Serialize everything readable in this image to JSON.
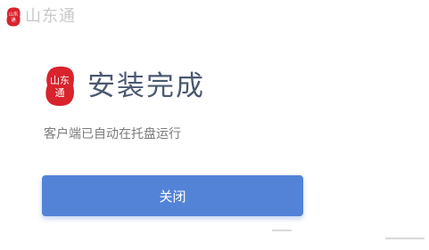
{
  "window": {
    "app_title": "山东通"
  },
  "logo": {
    "text_line1": "山东",
    "text_line2": "通",
    "color": "#d9232d"
  },
  "main": {
    "heading": "安装完成",
    "subtext": "客户端已自动在托盘运行",
    "close_label": "关闭"
  },
  "colors": {
    "button": "#5283d7",
    "heading": "#4b5870",
    "subtext": "#7a7a7a",
    "title": "#c9c9c9"
  }
}
